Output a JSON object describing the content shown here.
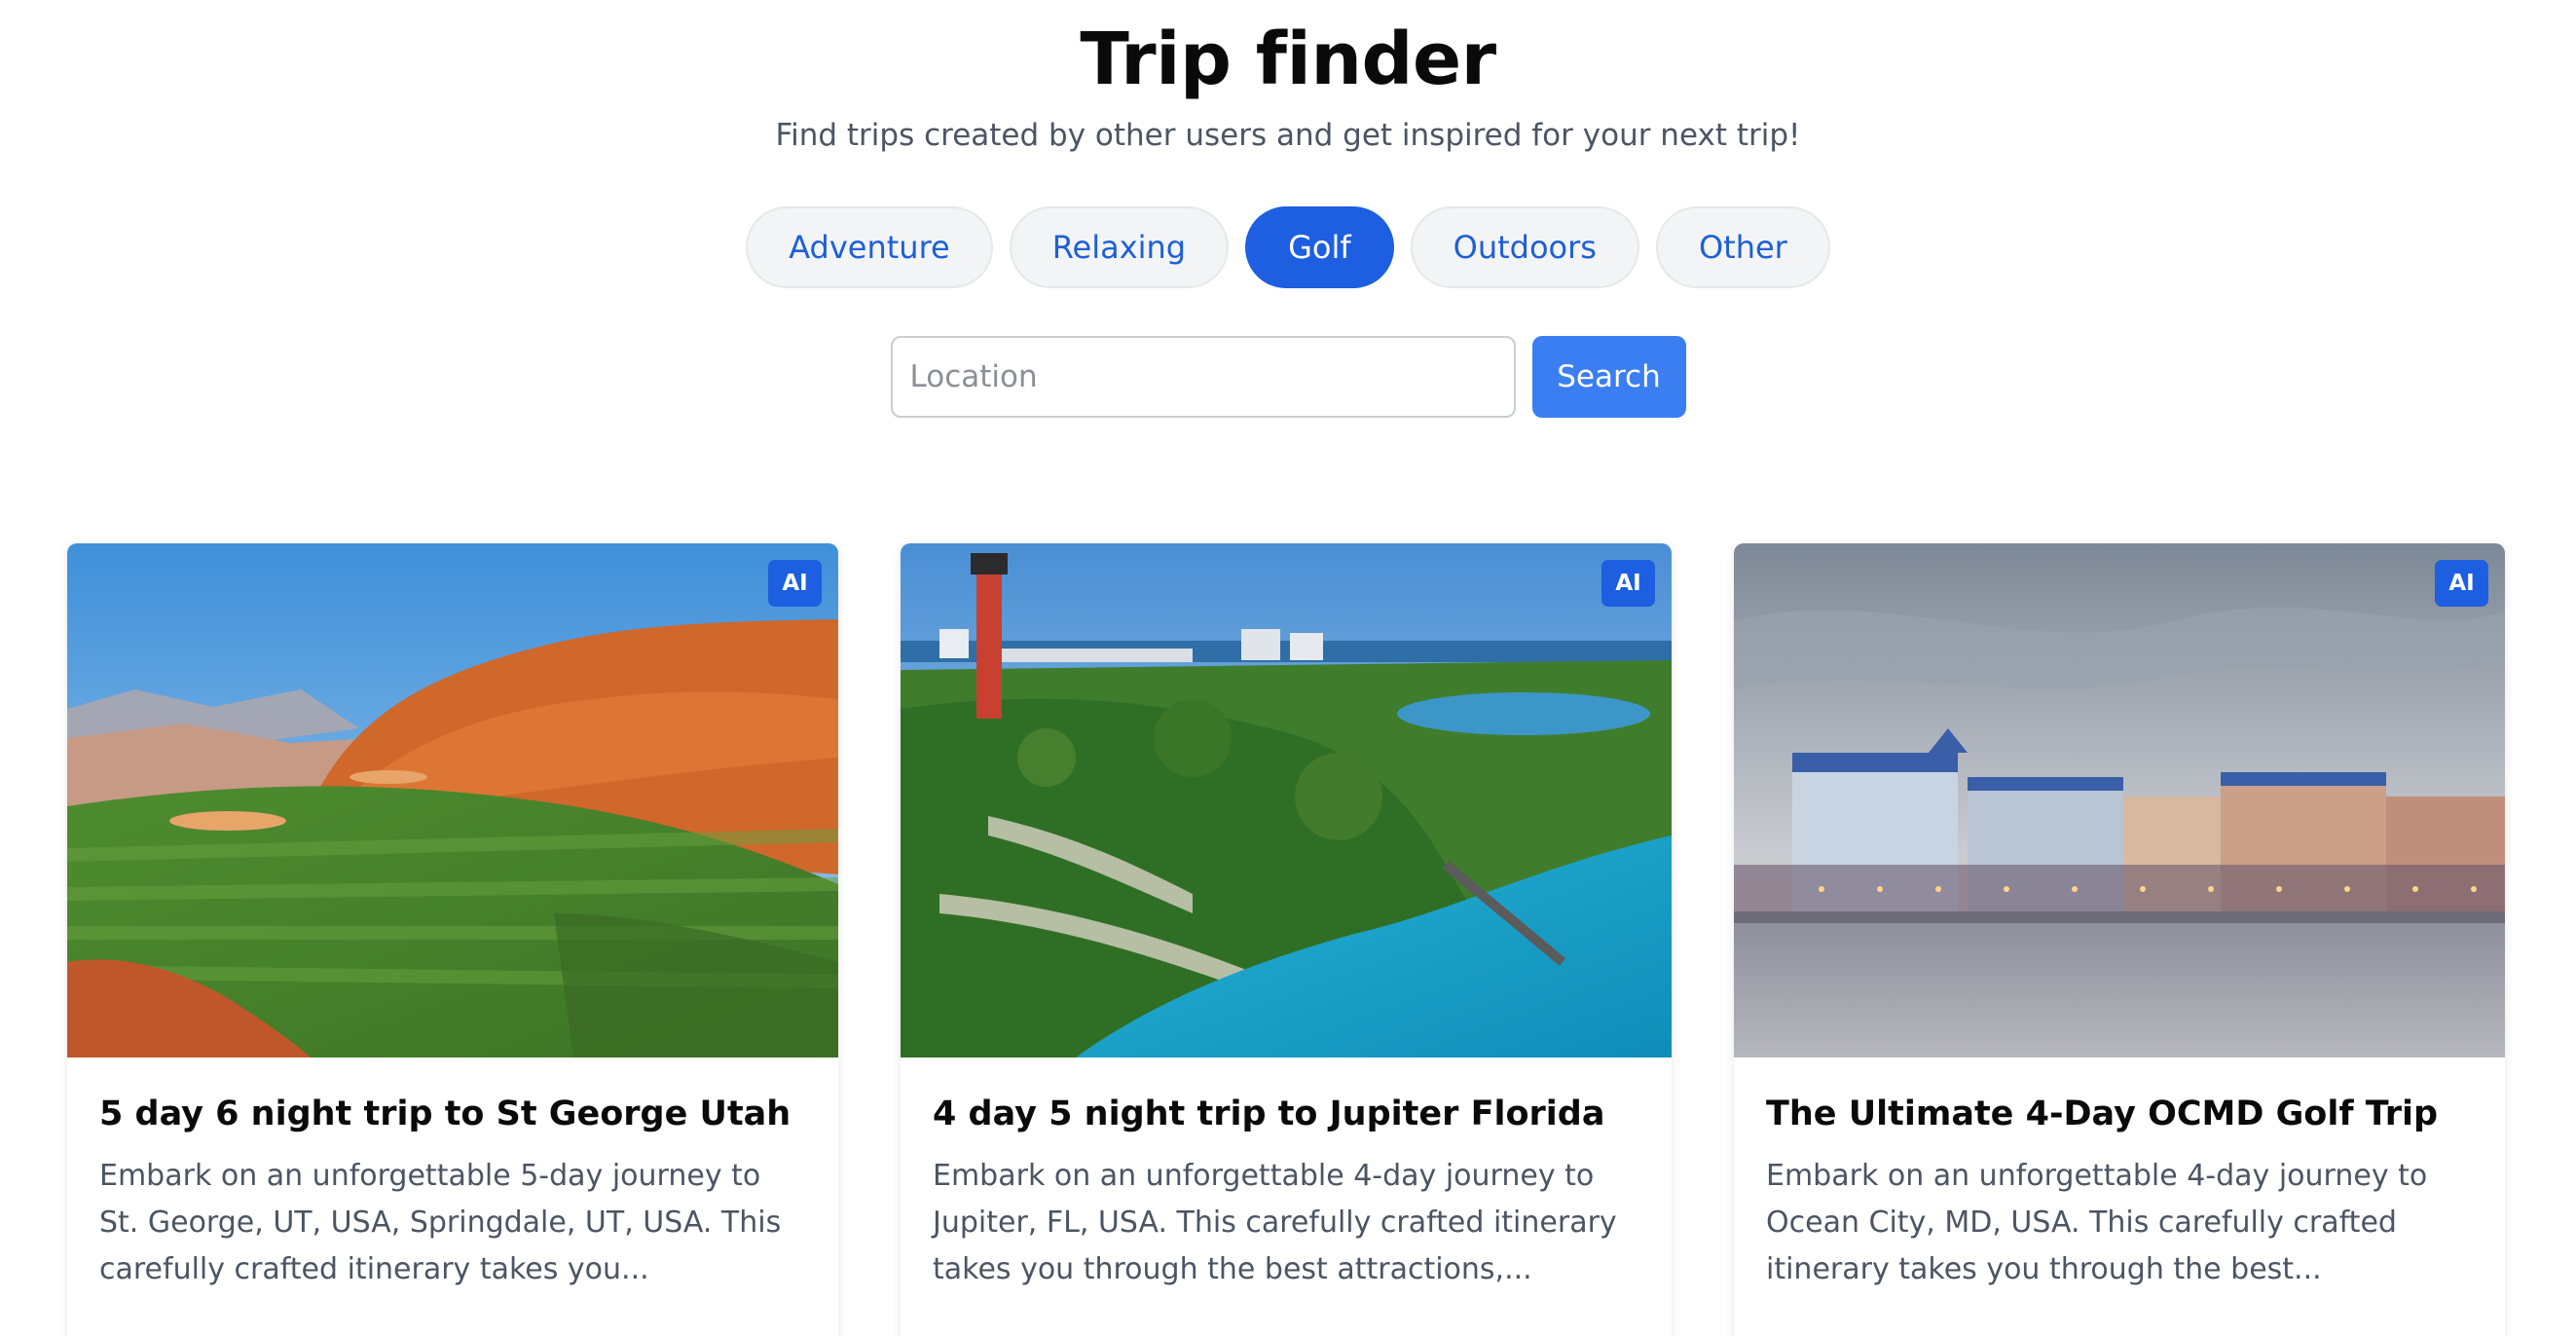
{
  "header": {
    "title": "Trip finder",
    "subtitle": "Find trips created by other users and get inspired for your next trip!"
  },
  "filters": [
    {
      "label": "Adventure",
      "active": false
    },
    {
      "label": "Relaxing",
      "active": false
    },
    {
      "label": "Golf",
      "active": true
    },
    {
      "label": "Outdoors",
      "active": false
    },
    {
      "label": "Other",
      "active": false
    }
  ],
  "search": {
    "placeholder": "Location",
    "value": "",
    "button_label": "Search"
  },
  "colors": {
    "accent": "#1d5fe0",
    "search_button": "#3a7ef2"
  },
  "cards": [
    {
      "badge": "AI",
      "title": "5 day 6 night trip to St George Utah",
      "description": "Embark on an unforgettable 5-day journey to St. George, UT, USA, Springdale, UT, USA. This carefully crafted itinerary takes you...",
      "image_icon": "golf-course-photo"
    },
    {
      "badge": "AI",
      "title": "4 day 5 night trip to Jupiter Florida",
      "description": "Embark on an unforgettable 4-day journey to Jupiter, FL, USA. This carefully crafted itinerary takes you through the best attractions,...",
      "image_icon": "lighthouse-coast-photo"
    },
    {
      "badge": "AI",
      "title": "The Ultimate 4-Day OCMD Golf Trip",
      "description": "Embark on an unforgettable 4-day journey to Ocean City, MD, USA. This carefully crafted itinerary takes you through the best...",
      "image_icon": "boardwalk-hotel-photo"
    }
  ]
}
